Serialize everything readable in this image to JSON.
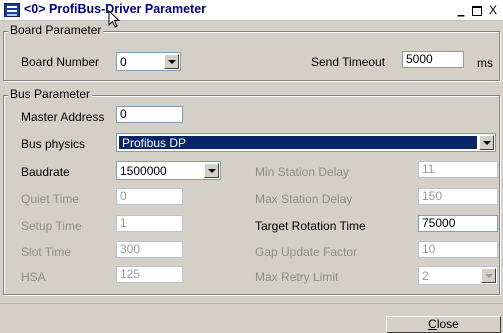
{
  "window": {
    "title": "<0> ProfiBus-Driver Parameter",
    "minimize_glyph": "_",
    "close_glyph": "X"
  },
  "board_parameter": {
    "legend": "Board Parameter",
    "board_number_label": "Board Number",
    "board_number_value": "0",
    "send_timeout_label": "Send Timeout",
    "send_timeout_value": "5000",
    "send_timeout_unit": "ms"
  },
  "bus_parameter": {
    "legend": "Bus Parameter",
    "master_address_label": "Master Address",
    "master_address_value": "0",
    "bus_physics_label": "Bus physics",
    "bus_physics_value": "Profibus DP",
    "baudrate_label": "Baudrate",
    "baudrate_value": "1500000",
    "quiet_time_label": "Quiet Time",
    "quiet_time_value": "0",
    "setup_time_label": "Setup Time",
    "setup_time_value": "1",
    "slot_time_label": "Slot Time",
    "slot_time_value": "300",
    "hsa_label": "HSA",
    "hsa_value": "125",
    "min_station_delay_label": "Min Station Delay",
    "min_station_delay_value": "11",
    "max_station_delay_label": "Max Station Delay",
    "max_station_delay_value": "150",
    "target_rotation_time_label": "Target Rotation Time",
    "target_rotation_time_value": "75000",
    "gap_update_factor_label": "Gap Update Factor",
    "gap_update_factor_value": "10",
    "max_retry_limit_label": "Max Retry Limit",
    "max_retry_limit_value": "2"
  },
  "footer": {
    "close_label_prefix": "C",
    "close_label_rest": "lose"
  },
  "icons": {
    "app": "profibus-app-icon",
    "cursor": "mouse-pointer-icon"
  },
  "colors": {
    "selection": "#0a246a",
    "title_text": "#000080"
  }
}
